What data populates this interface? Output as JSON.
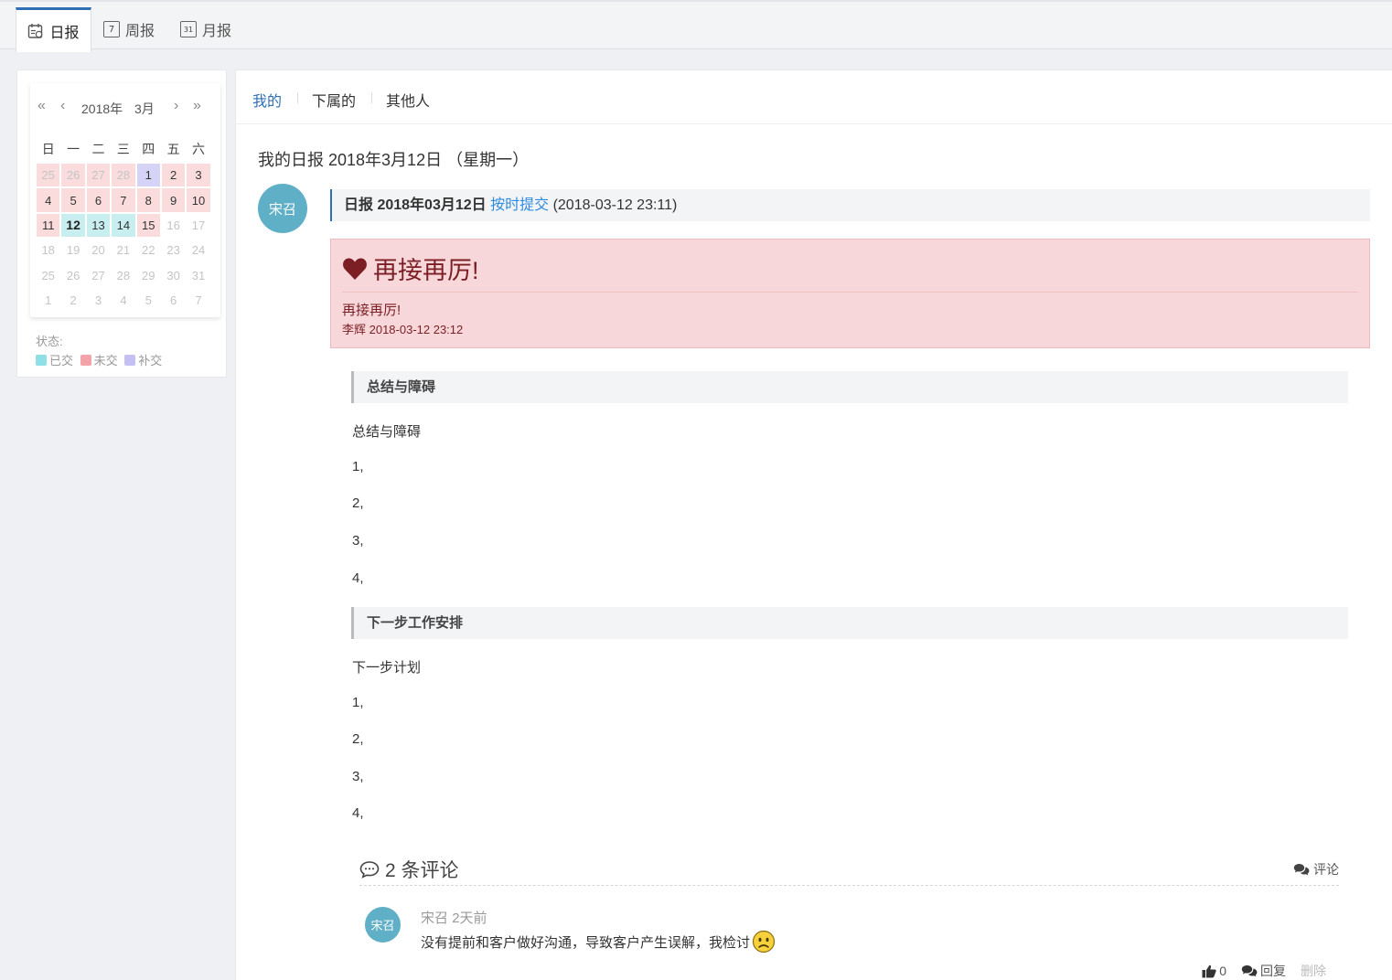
{
  "top_tabs": [
    {
      "label": "日报",
      "icon": "daily-report-icon"
    },
    {
      "label": "周报",
      "icon": "calendar-7-icon",
      "glyph": "7"
    },
    {
      "label": "月报",
      "icon": "calendar-31-icon",
      "glyph": "31"
    }
  ],
  "calendar": {
    "year": "2018年",
    "month": "3月",
    "weekdays": [
      "日",
      "一",
      "二",
      "三",
      "四",
      "五",
      "六"
    ],
    "days": [
      {
        "d": "25",
        "s": "miss",
        "faded": true
      },
      {
        "d": "26",
        "s": "miss",
        "faded": true
      },
      {
        "d": "27",
        "s": "miss",
        "faded": true
      },
      {
        "d": "28",
        "s": "miss",
        "faded": true
      },
      {
        "d": "1",
        "s": "late"
      },
      {
        "d": "2",
        "s": "miss"
      },
      {
        "d": "3",
        "s": "miss"
      },
      {
        "d": "4",
        "s": "miss"
      },
      {
        "d": "5",
        "s": "miss"
      },
      {
        "d": "6",
        "s": "miss"
      },
      {
        "d": "7",
        "s": "miss"
      },
      {
        "d": "8",
        "s": "miss"
      },
      {
        "d": "9",
        "s": "miss"
      },
      {
        "d": "10",
        "s": "miss"
      },
      {
        "d": "11",
        "s": "miss"
      },
      {
        "d": "12",
        "s": "done",
        "today": true
      },
      {
        "d": "13",
        "s": "done"
      },
      {
        "d": "14",
        "s": "done"
      },
      {
        "d": "15",
        "s": "miss"
      },
      {
        "d": "16",
        "s": "",
        "faded": true
      },
      {
        "d": "17",
        "s": "",
        "faded": true
      },
      {
        "d": "18",
        "s": "",
        "faded": true
      },
      {
        "d": "19",
        "s": "",
        "faded": true
      },
      {
        "d": "20",
        "s": "",
        "faded": true
      },
      {
        "d": "21",
        "s": "",
        "faded": true
      },
      {
        "d": "22",
        "s": "",
        "faded": true
      },
      {
        "d": "23",
        "s": "",
        "faded": true
      },
      {
        "d": "24",
        "s": "",
        "faded": true
      },
      {
        "d": "25",
        "s": "",
        "faded": true
      },
      {
        "d": "26",
        "s": "",
        "faded": true
      },
      {
        "d": "27",
        "s": "",
        "faded": true
      },
      {
        "d": "28",
        "s": "",
        "faded": true
      },
      {
        "d": "29",
        "s": "",
        "faded": true
      },
      {
        "d": "30",
        "s": "",
        "faded": true
      },
      {
        "d": "31",
        "s": "",
        "faded": true
      },
      {
        "d": "1",
        "s": "",
        "faded": true
      },
      {
        "d": "2",
        "s": "",
        "faded": true
      },
      {
        "d": "3",
        "s": "",
        "faded": true
      },
      {
        "d": "4",
        "s": "",
        "faded": true
      },
      {
        "d": "5",
        "s": "",
        "faded": true
      },
      {
        "d": "6",
        "s": "",
        "faded": true
      },
      {
        "d": "7",
        "s": "",
        "faded": true
      }
    ]
  },
  "legend": {
    "label": "状态:",
    "items": [
      {
        "label": "已交",
        "color": "#8fdfe6"
      },
      {
        "label": "未交",
        "color": "#f4a3a8"
      },
      {
        "label": "补交",
        "color": "#c4c0f2"
      }
    ]
  },
  "sub_tabs": [
    "我的",
    "下属的",
    "其他人"
  ],
  "page_title": "我的日报 2018年3月12日 （星期一）",
  "report": {
    "author_avatar": "宋召",
    "head_prefix": "日报 2018年03月12日",
    "status": "按时提交",
    "submitted_at": "(2018-03-12 23:11)"
  },
  "praise": {
    "title": "再接再厉!",
    "text": "再接再厉!",
    "meta": "李辉 2018-03-12 23:12"
  },
  "sections": [
    {
      "title": "总结与障碍",
      "lines": [
        "总结与障碍",
        "1,",
        "2,",
        "3,",
        "4,"
      ]
    },
    {
      "title": "下一步工作安排",
      "lines": [
        "下一步计划",
        "1,",
        "2,",
        "3,",
        "4,"
      ]
    }
  ],
  "comments": {
    "title": "2 条评论",
    "add_label": "评论",
    "items": [
      {
        "avatar": "宋召",
        "name": "宋召",
        "time": "2天前",
        "text": "没有提前和客户做好沟通，导致客户产生误解，我检讨",
        "likes": "0",
        "reply_label": "回复",
        "delete_label": "删除"
      }
    ]
  },
  "colors": {
    "accent": "#2f6fb5",
    "avatar": "#5fafc7",
    "praise_bg": "#f8d7da"
  }
}
